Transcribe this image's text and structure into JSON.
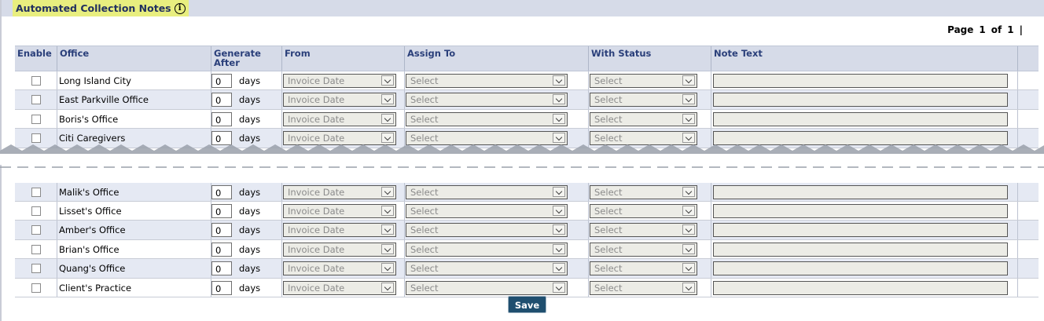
{
  "title": "Automated Collection Notes",
  "pager": {
    "page_word": "Page",
    "current": "1",
    "of_word": "of",
    "total": "1",
    "sep": "|"
  },
  "headers": {
    "enable": "Enable",
    "office": "Office",
    "generate_after": "Generate After",
    "from": "From",
    "assign_to": "Assign To",
    "with_status": "With Status",
    "note_text": "Note Text"
  },
  "rows_top": [
    {
      "office": "Long Island City",
      "days": "0",
      "days_label": "days",
      "from": "Invoice Date",
      "assign": "Select",
      "status": "Select",
      "enabled": false
    },
    {
      "office": "East Parkville Office",
      "days": "0",
      "days_label": "days",
      "from": "Invoice Date",
      "assign": "Select",
      "status": "Select",
      "enabled": false
    },
    {
      "office": "Boris's Office",
      "days": "0",
      "days_label": "days",
      "from": "Invoice Date",
      "assign": "Select",
      "status": "Select",
      "enabled": false
    },
    {
      "office": "Citi Caregivers",
      "days": "0",
      "days_label": "days",
      "from": "Invoice Date",
      "assign": "Select",
      "status": "Select",
      "enabled": false
    }
  ],
  "rows_bottom": [
    {
      "office": "Malik's Office",
      "days": "0",
      "days_label": "days",
      "from": "Invoice Date",
      "assign": "Select",
      "status": "Select",
      "enabled": false
    },
    {
      "office": "Lisset's Office",
      "days": "0",
      "days_label": "days",
      "from": "Invoice Date",
      "assign": "Select",
      "status": "Select",
      "enabled": false
    },
    {
      "office": "Amber's Office",
      "days": "0",
      "days_label": "days",
      "from": "Invoice Date",
      "assign": "Select",
      "status": "Select",
      "enabled": false
    },
    {
      "office": "Brian's Office",
      "days": "0",
      "days_label": "days",
      "from": "Invoice Date",
      "assign": "Select",
      "status": "Select",
      "enabled": false
    },
    {
      "office": "Quang's Office",
      "days": "0",
      "days_label": "days",
      "from": "Invoice Date",
      "assign": "Select",
      "status": "Select",
      "enabled": false
    },
    {
      "office": "Client's Practice",
      "days": "0",
      "days_label": "days",
      "from": "Invoice Date",
      "assign": "Select",
      "status": "Select",
      "enabled": false
    }
  ],
  "save_label": "Save",
  "colors": {
    "header_bg": "#d6dbe8",
    "title_highlight": "#e8ee7f",
    "save_bg": "#1f4f6f",
    "header_text": "#2a3f7a"
  }
}
